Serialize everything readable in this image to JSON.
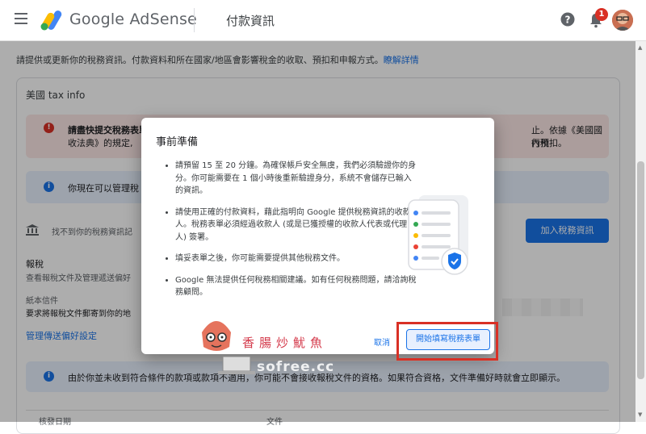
{
  "header": {
    "brand": "Google AdSense",
    "page_title": "付款資訊",
    "notification_count": "1",
    "icons": [
      "menu-icon",
      "adsense-logo",
      "help-icon",
      "bell-icon",
      "avatar"
    ]
  },
  "intro": {
    "text": "請提供或更新你的稅務資訊。付款資料和所在國家/地區會影響稅金的收取、預扣和申報方式。",
    "link": "瞭解詳情"
  },
  "card": {
    "title": "美國 tax info",
    "alert_red": {
      "title": "請盡快提交稅務表單",
      "line2": "收法典》的規定,",
      "right1": "止。依據《美國國內稅",
      "right2": "行預扣。"
    },
    "alert_blue": {
      "text": "你現在可以管理稅"
    },
    "not_found": "找不到你的稅務資訊記",
    "add_button": "加入稅務資訊",
    "tax_section_title": "報稅",
    "tax_section_desc": "查看報稅文件及管理遞送偏好",
    "paper_title": "紙本信件",
    "paper_desc": "要求將報稅文件郵寄到你的地",
    "manage_link": "管理傳送偏好設定",
    "bottom_alert": "由於你並未收到符合條件的款項或款項不適用，你可能不會接收報稅文件的資格。如果符合資格，文件準備好時就會立即顯示。",
    "table_headers": [
      "核發日期",
      "文件"
    ]
  },
  "dialog": {
    "title": "事前準備",
    "bullets": [
      "請預留 15 至 20 分鐘。為確保帳戶安全無虞，我們必須驗證你的身分。你可能需要在 1 個小時後重新驗證身分，系統不會儲存已輸入的資訊。",
      "請使用正確的付款資料，藉此指明向 Google 提供稅務資訊的收款人。稅務表單必須經過收款人 (或是已獲授權的收款人代表或代理人) 簽署。",
      "填妥表單之後，你可能需要提供其他稅務文件。",
      "Google 無法提供任何稅務相關建議。如有任何稅務問題，請洽詢稅務顧問。"
    ],
    "cancel_label": "取消",
    "start_label": "開始填寫稅務表單"
  },
  "watermark": {
    "text": "香腸炒魷魚",
    "url": "sofree.cc"
  },
  "colors": {
    "accent": "#1a73e8",
    "error": "#d93025",
    "highlight_box": "#d93025"
  }
}
